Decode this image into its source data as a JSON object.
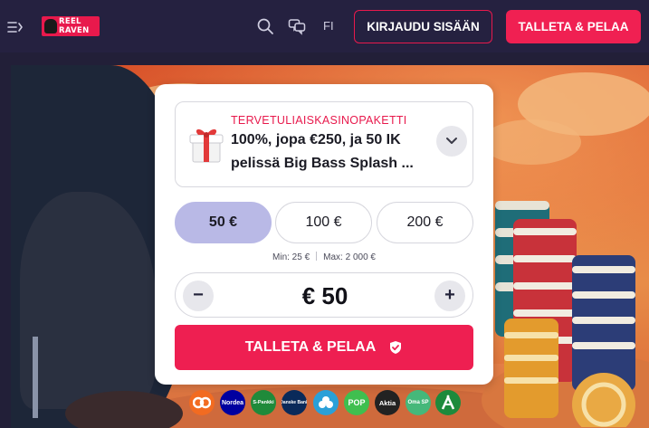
{
  "header": {
    "brand_line1": "REEL",
    "brand_line2": "RAVEN",
    "language": "FI",
    "login_label": "KIRJAUDU SISÄÄN",
    "deposit_label": "TALLETA & PELAA",
    "icons": [
      "menu-icon",
      "search-icon",
      "chat-icon"
    ]
  },
  "promo": {
    "tag": "TERVETULIAISKASINOPAKETTI",
    "line1": "100%, jopa €250, ja 50 IK",
    "line2": "pelissä Big Bass Splash ...",
    "icon": "gift-icon",
    "toggle_icon": "chevron-down-icon"
  },
  "amounts": {
    "options": [
      "50 €",
      "100 €",
      "200 €"
    ],
    "selected": "50 €",
    "min_label": "Min: 25 €",
    "max_label": "Max: 2 000 €"
  },
  "stepper": {
    "minus": "−",
    "plus": "+",
    "value": "€ 50"
  },
  "deposit_button": {
    "label": "TALLETA & PELAA",
    "icon": "shield-check-icon"
  },
  "banks": [
    {
      "label": "op",
      "color": "#f26b21"
    },
    {
      "label": "Nordea",
      "color": "#0000a0"
    },
    {
      "label": "S-Pankki",
      "color": "#1f8a3a"
    },
    {
      "label": "Danske Bank",
      "color": "#0a2a5a"
    },
    {
      "label": "Säästöpankki",
      "color": "#2aa0d8"
    },
    {
      "label": "POP",
      "color": "#3fbf4f"
    },
    {
      "label": "Aktia",
      "color": "#222222"
    },
    {
      "label": "Oma SP",
      "color": "#45b87a"
    },
    {
      "label": "Ålandsbanken",
      "color": "#1d8a3c"
    }
  ],
  "colors": {
    "accent": "#ee1f51",
    "header_bg": "#252140",
    "selected_amount": "#b9b9e6"
  }
}
